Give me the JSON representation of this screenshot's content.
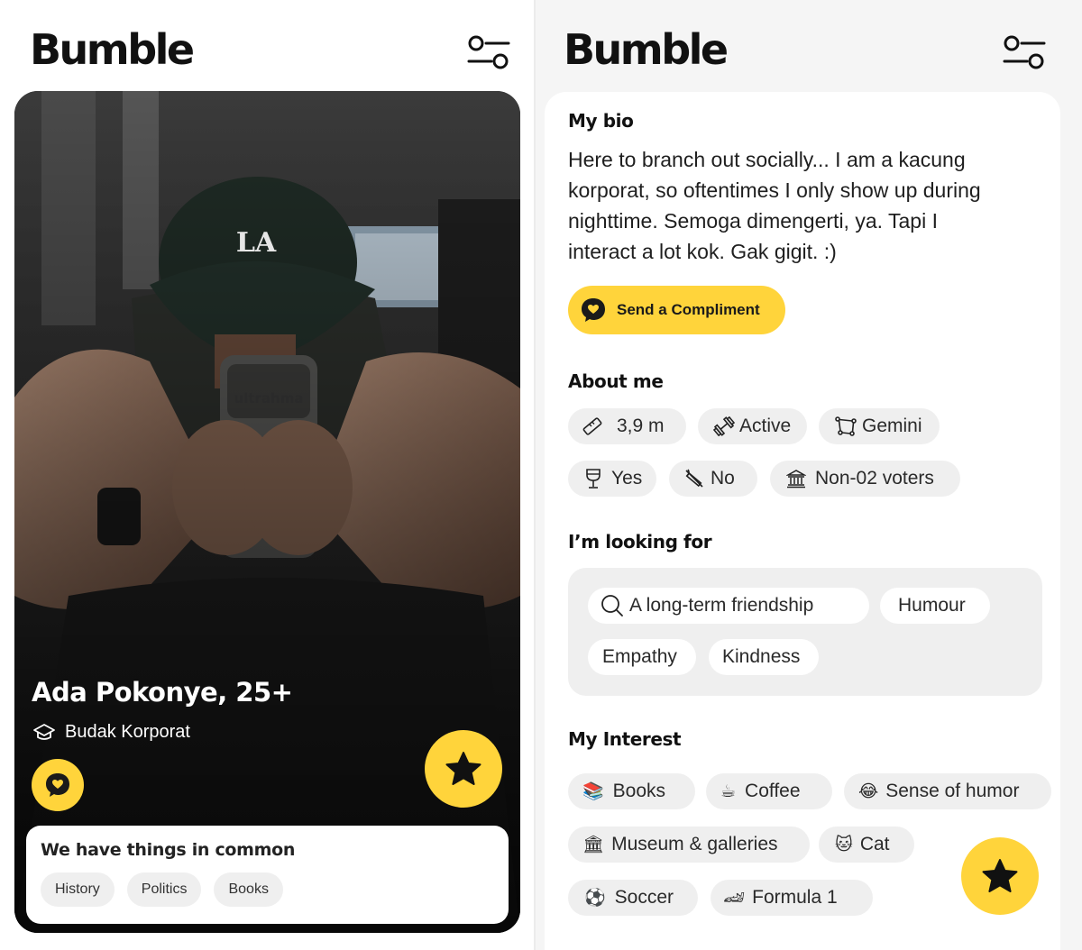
{
  "left": {
    "logo": "Bumble",
    "profile": {
      "name": "Ada Pokonye, 25+",
      "education": "Budak Korporat",
      "cap_text": "LA",
      "phone_text": "ultrahma"
    },
    "common": {
      "title": "We have things in common",
      "chips": [
        "History",
        "Politics",
        "Books"
      ]
    }
  },
  "right": {
    "logo": "Bumble",
    "bio": {
      "heading": "My bio",
      "lines": [
        "Here to branch out socially... I am a kacung",
        "korporat, so oftentimes I only show up during",
        "nighttime. Semoga dimengerti, ya. Tapi I",
        "interact a lot kok. Gak gigit. :)"
      ],
      "compliment_label": "Send a Compliment"
    },
    "about": {
      "heading": "About me",
      "chips": [
        {
          "icon": "ruler-icon",
          "label": "3,9 m"
        },
        {
          "icon": "dumbbell-icon",
          "label": "Active"
        },
        {
          "icon": "zodiac-icon",
          "label": "Gemini"
        },
        {
          "icon": "wine-glass-icon",
          "label": "Yes"
        },
        {
          "icon": "no-smoking-icon",
          "label": "No"
        },
        {
          "icon": "institution-icon",
          "label": "Non-02 voters"
        }
      ]
    },
    "looking": {
      "heading": "I’m looking for",
      "chips": [
        "A long-term friendship",
        "Humour",
        "Empathy",
        "Kindness"
      ]
    },
    "interests": {
      "heading": "My Interest",
      "chips": [
        {
          "emoji": "📚",
          "label": "Books"
        },
        {
          "emoji": "☕",
          "label": "Coffee"
        },
        {
          "emoji": "😂",
          "label": "Sense of humor"
        },
        {
          "emoji": "🏛",
          "label": "Museum & galleries"
        },
        {
          "emoji": "🐱",
          "label": "Cat"
        },
        {
          "emoji": "⚽",
          "label": "Soccer"
        },
        {
          "emoji": "🏎",
          "label": "Formula 1"
        }
      ]
    }
  },
  "colors": {
    "accent": "#ffd43b",
    "chip_bg": "#efefef",
    "text": "#1a1a1a"
  }
}
